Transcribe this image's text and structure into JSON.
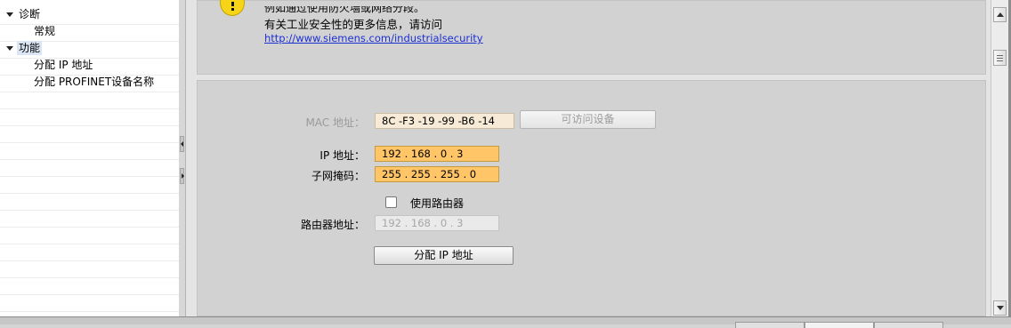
{
  "tree": {
    "items": [
      {
        "label": "诊断",
        "expanded": true
      },
      {
        "label": "常规"
      },
      {
        "label": "功能",
        "expanded": true,
        "selected": true
      },
      {
        "label": "分配 IP 地址"
      },
      {
        "label": "分配 PROFINET设备名称"
      }
    ]
  },
  "info": {
    "line1": "例如通过使用防火墙或网络分段。",
    "line2": "有关工业安全性的更多信息，请访问",
    "link": "http://www.siemens.com/industrialsecurity"
  },
  "form": {
    "mac_label": "MAC 地址：",
    "mac_value": "8C -F3 -19 -99 -B6 -14",
    "accessible_devices_button": "可访问设备",
    "ip_label": "IP 地址：",
    "ip_value": "192 . 168 . 0     . 3",
    "subnet_label": "子网掩码：",
    "subnet_value": "255 . 255 . 255 . 0",
    "use_router_label": "使用路由器",
    "use_router_checked": false,
    "router_label": "路由器地址：",
    "router_value": "192 . 168 . 0     . 3",
    "assign_button": "分配 IP 地址"
  },
  "colors": {
    "field_highlight": "#ffc566",
    "link": "#1b2fd4",
    "warning_icon": "#f7d417"
  }
}
